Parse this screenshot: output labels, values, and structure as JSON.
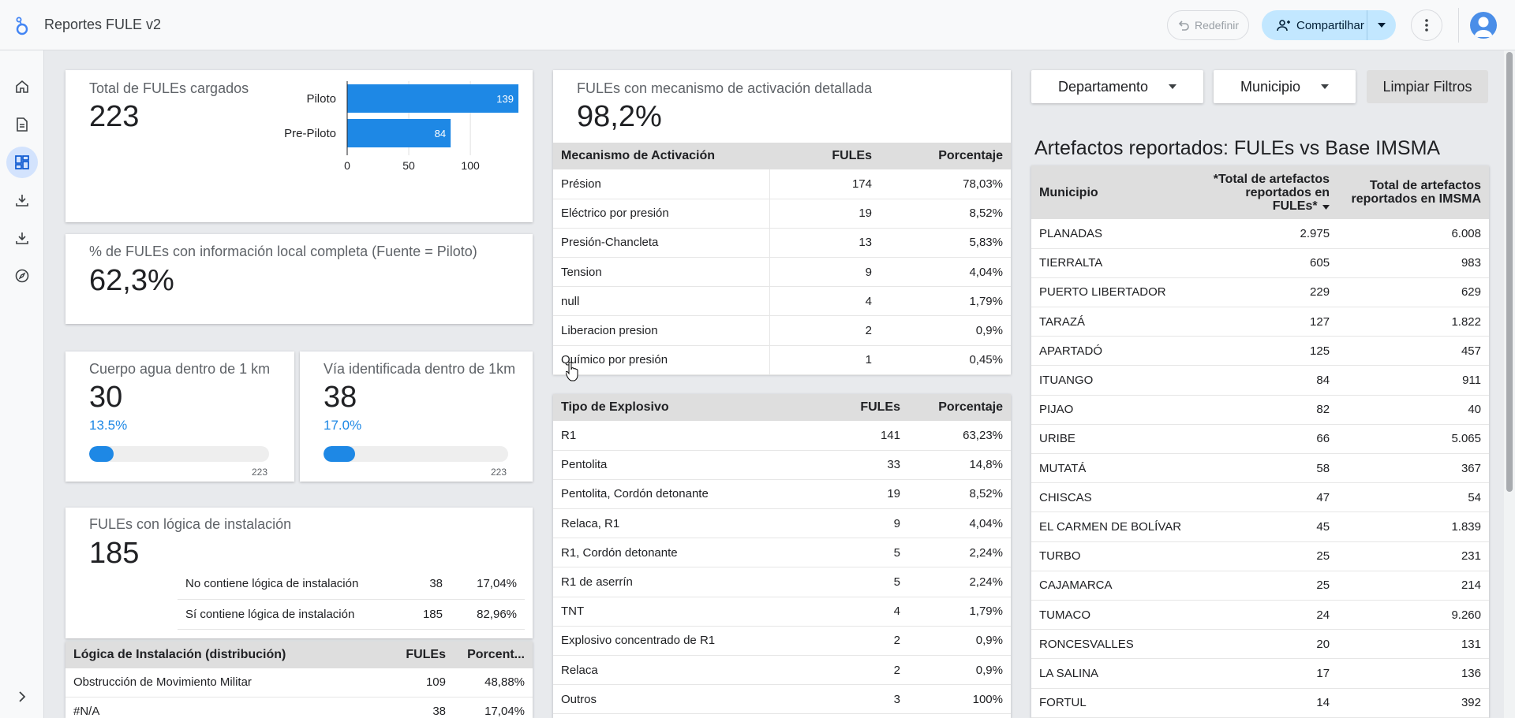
{
  "app": {
    "title": "Reportes FULE v2"
  },
  "toolbar": {
    "reset_label": "Redefinir",
    "share_label": "Compartilhar"
  },
  "colors": {
    "accent": "#1e88e5",
    "share_bg": "#c2e7ff",
    "header_bg": "#dedede"
  },
  "rail": {
    "icons": [
      "home-icon",
      "report-icon",
      "dashboard-icon",
      "download-icon",
      "download-icon",
      "explore-icon"
    ],
    "expand_icon": "chevron-right-icon"
  },
  "kpi_total": {
    "label": "Total de FULEs cargados",
    "value": "223",
    "chart_data": {
      "type": "bar",
      "orientation": "horizontal",
      "categories": [
        "Piloto",
        "Pre-Piloto"
      ],
      "values": [
        139,
        84
      ],
      "value_labels": [
        "139",
        "84"
      ],
      "xlim": [
        0,
        139
      ],
      "xticks": [
        "0",
        "50",
        "100"
      ],
      "grid": true
    }
  },
  "kpi_info": {
    "label": "% de FULEs con información local completa (Fuente = Piloto)",
    "value": "62,3%"
  },
  "kpi_agua": {
    "label": "Cuerpo agua dentro de 1 km",
    "value": "30",
    "percent": "13.5%",
    "progress": 0.135,
    "max_label": "223"
  },
  "kpi_via": {
    "label": "Vía identificada dentro de 1km",
    "value": "38",
    "percent": "17.0%",
    "progress": 0.17,
    "max_label": "223"
  },
  "kpi_logica": {
    "label": "FULEs con lógica de instalación",
    "value": "185",
    "rows": [
      {
        "label": "No contiene lógica de instalación",
        "count": "38",
        "pct": "17,04%"
      },
      {
        "label": "Sí contiene lógica de instalación",
        "count": "185",
        "pct": "82,96%"
      }
    ]
  },
  "logica_table": {
    "headers": [
      "Lógica de Instalación (distribución)",
      "FULEs",
      "Porcent..."
    ],
    "rows": [
      [
        "Obstrucción de Movimiento Militar",
        "109",
        "48,88%"
      ],
      [
        "#N/A",
        "38",
        "17,04%"
      ]
    ]
  },
  "mecanismo": {
    "title": "FULEs con mecanismo de activación detallada",
    "value": "98,2%",
    "headers": [
      "Mecanismo de Activación",
      "FULEs",
      "Porcentaje"
    ],
    "rows": [
      [
        "Présion",
        "174",
        "78,03%"
      ],
      [
        "Eléctrico por presión",
        "19",
        "8,52%"
      ],
      [
        "Presión-Chancleta",
        "13",
        "5,83%"
      ],
      [
        "Tension",
        "9",
        "4,04%"
      ],
      [
        "null",
        "4",
        "1,79%"
      ],
      [
        "Liberacion presion",
        "2",
        "0,9%"
      ],
      [
        "Químico por presión",
        "1",
        "0,45%"
      ]
    ]
  },
  "explosivo": {
    "headers": [
      "Tipo de Explosivo",
      "FULEs",
      "Porcentaje"
    ],
    "rows": [
      [
        "R1",
        "141",
        "63,23%"
      ],
      [
        "Pentolita",
        "33",
        "14,8%"
      ],
      [
        "Pentolita, Cordón detonante",
        "19",
        "8,52%"
      ],
      [
        "Relaca, R1",
        "9",
        "4,04%"
      ],
      [
        "R1, Cordón detonante",
        "5",
        "2,24%"
      ],
      [
        "R1 de aserrín",
        "5",
        "2,24%"
      ],
      [
        "TNT",
        "4",
        "1,79%"
      ],
      [
        "Explosivo concentrado de R1",
        "2",
        "0,9%"
      ],
      [
        "Relaca",
        "2",
        "0,9%"
      ],
      [
        "Outros",
        "3",
        "100%"
      ]
    ]
  },
  "filters": {
    "departamento": "Departamento",
    "municipio": "Municipio",
    "clear": "Limpiar Filtros"
  },
  "imsma": {
    "title": "Artefactos reportados: FULEs vs Base IMSMA",
    "headers": [
      "Municipio",
      "*Total de artefactos reportados en FULEs*",
      "Total de artefactos reportados en IMSMA"
    ],
    "rows": [
      [
        "PLANADAS",
        "2.975",
        "6.008"
      ],
      [
        "TIERRALTA",
        "605",
        "983"
      ],
      [
        "PUERTO LIBERTADOR",
        "229",
        "629"
      ],
      [
        "TARAZÁ",
        "127",
        "1.822"
      ],
      [
        "APARTADÓ",
        "125",
        "457"
      ],
      [
        "ITUANGO",
        "84",
        "911"
      ],
      [
        "PIJAO",
        "82",
        "40"
      ],
      [
        "URIBE",
        "66",
        "5.065"
      ],
      [
        "MUTATÁ",
        "58",
        "367"
      ],
      [
        "CHISCAS",
        "47",
        "54"
      ],
      [
        "EL CARMEN DE BOLÍVAR",
        "45",
        "1.839"
      ],
      [
        "TURBO",
        "25",
        "231"
      ],
      [
        "CAJAMARCA",
        "25",
        "214"
      ],
      [
        "TUMACO",
        "24",
        "9.260"
      ],
      [
        "RONCESVALLES",
        "20",
        "131"
      ],
      [
        "LA SALINA",
        "17",
        "136"
      ],
      [
        "FORTUL",
        "14",
        "392"
      ]
    ]
  }
}
